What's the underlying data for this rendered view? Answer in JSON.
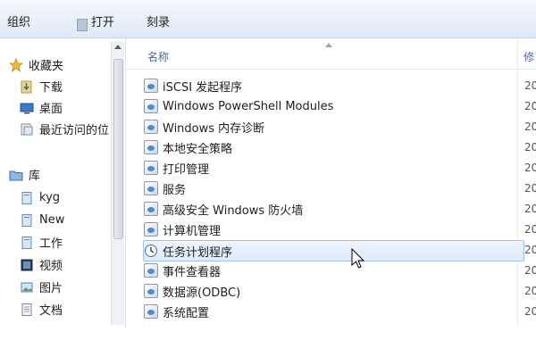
{
  "toolbar": {
    "organize": "组织",
    "open": "打开",
    "burn": "刻录"
  },
  "nav": {
    "favorites": [
      {
        "label": "收藏夹",
        "icon": "star-icon"
      },
      {
        "label": "下载",
        "icon": "download-folder-icon"
      },
      {
        "label": "桌面",
        "icon": "desktop-icon"
      },
      {
        "label": "最近访问的位",
        "icon": "recent-places-icon"
      }
    ],
    "libraries": [
      {
        "label": "库",
        "icon": "library-icon"
      },
      {
        "label": "kyg",
        "icon": "library-folder-icon"
      },
      {
        "label": "New",
        "icon": "library-folder-icon"
      },
      {
        "label": "工作",
        "icon": "library-folder-icon"
      },
      {
        "label": "视频",
        "icon": "video-library-icon"
      },
      {
        "label": "图片",
        "icon": "pictures-library-icon"
      },
      {
        "label": "文档",
        "icon": "documents-library-icon"
      }
    ]
  },
  "list": {
    "columns": {
      "name": "名称",
      "modified": "修"
    },
    "rows": [
      {
        "name": "iSCSI 发起程序",
        "icon": "iscsi-icon",
        "modified": "20"
      },
      {
        "name": "Windows PowerShell Modules",
        "icon": "powershell-icon",
        "modified": "20"
      },
      {
        "name": "Windows 内存诊断",
        "icon": "memory-diagnostic-icon",
        "modified": "20"
      },
      {
        "name": "本地安全策略",
        "icon": "security-policy-icon",
        "modified": "20"
      },
      {
        "name": "打印管理",
        "icon": "print-management-icon",
        "modified": "20"
      },
      {
        "name": "服务",
        "icon": "services-icon",
        "modified": "20"
      },
      {
        "name": "高级安全 Windows 防火墙",
        "icon": "firewall-icon",
        "modified": "20"
      },
      {
        "name": "计算机管理",
        "icon": "computer-management-icon",
        "modified": "20"
      },
      {
        "name": "任务计划程序",
        "icon": "task-scheduler-icon",
        "modified": "20",
        "selected": true
      },
      {
        "name": "事件查看器",
        "icon": "event-viewer-icon",
        "modified": "20"
      },
      {
        "name": "数据源(ODBC)",
        "icon": "odbc-icon",
        "modified": "20"
      },
      {
        "name": "系统配置",
        "icon": "system-config-icon",
        "modified": "20"
      }
    ]
  },
  "colors": {
    "selection_fill": "#dcebfc",
    "selection_border": "#9fc4ee",
    "header_text": "#4a6a8f",
    "toolbar_top": "#f4f8fd",
    "toolbar_bottom": "#dfe9f5"
  }
}
